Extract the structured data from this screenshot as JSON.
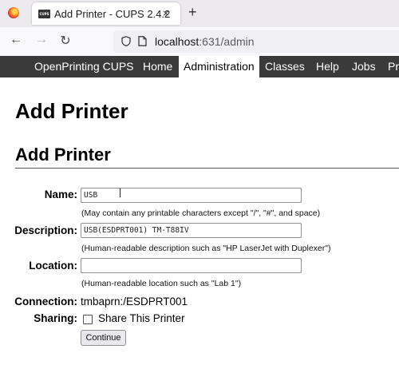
{
  "browser": {
    "tab_title": "Add Printer - CUPS 2.4.2",
    "tab_close": "×",
    "new_tab": "+",
    "favicon_text": "CUPS",
    "url_host": "localhost",
    "url_rest": ":631/admin"
  },
  "cups_nav": {
    "items": [
      {
        "label": "OpenPrinting CUPS"
      },
      {
        "label": "Home"
      },
      {
        "label": "Administration"
      },
      {
        "label": "Classes"
      },
      {
        "label": "Help"
      },
      {
        "label": "Jobs"
      },
      {
        "label": "Pr"
      }
    ],
    "active": "Administration"
  },
  "page": {
    "title": "Add Printer",
    "section_title": "Add Printer"
  },
  "form": {
    "name_label": "Name:",
    "name_value": "USB",
    "name_hint": "(May contain any printable characters except \"/\", \"#\", and space)",
    "description_label": "Description:",
    "description_value": "USB(ESDPRT001) TM-T88IV",
    "description_hint": "(Human-readable description such as \"HP LaserJet with Duplexer\")",
    "location_label": "Location:",
    "location_value": "",
    "location_hint": "(Human-readable location such as \"Lab 1\")",
    "connection_label": "Connection:",
    "connection_value": "tmbaprn:/ESDPRT001",
    "sharing_label": "Sharing:",
    "share_checkbox_label": "Share This Printer",
    "share_checked": false,
    "continue_label": "Continue"
  },
  "colors": {
    "cups_nav_bg": "#3a3a3a",
    "tabstrip_bg": "#eceaed",
    "toolbar_bg": "#f9f9fb"
  }
}
